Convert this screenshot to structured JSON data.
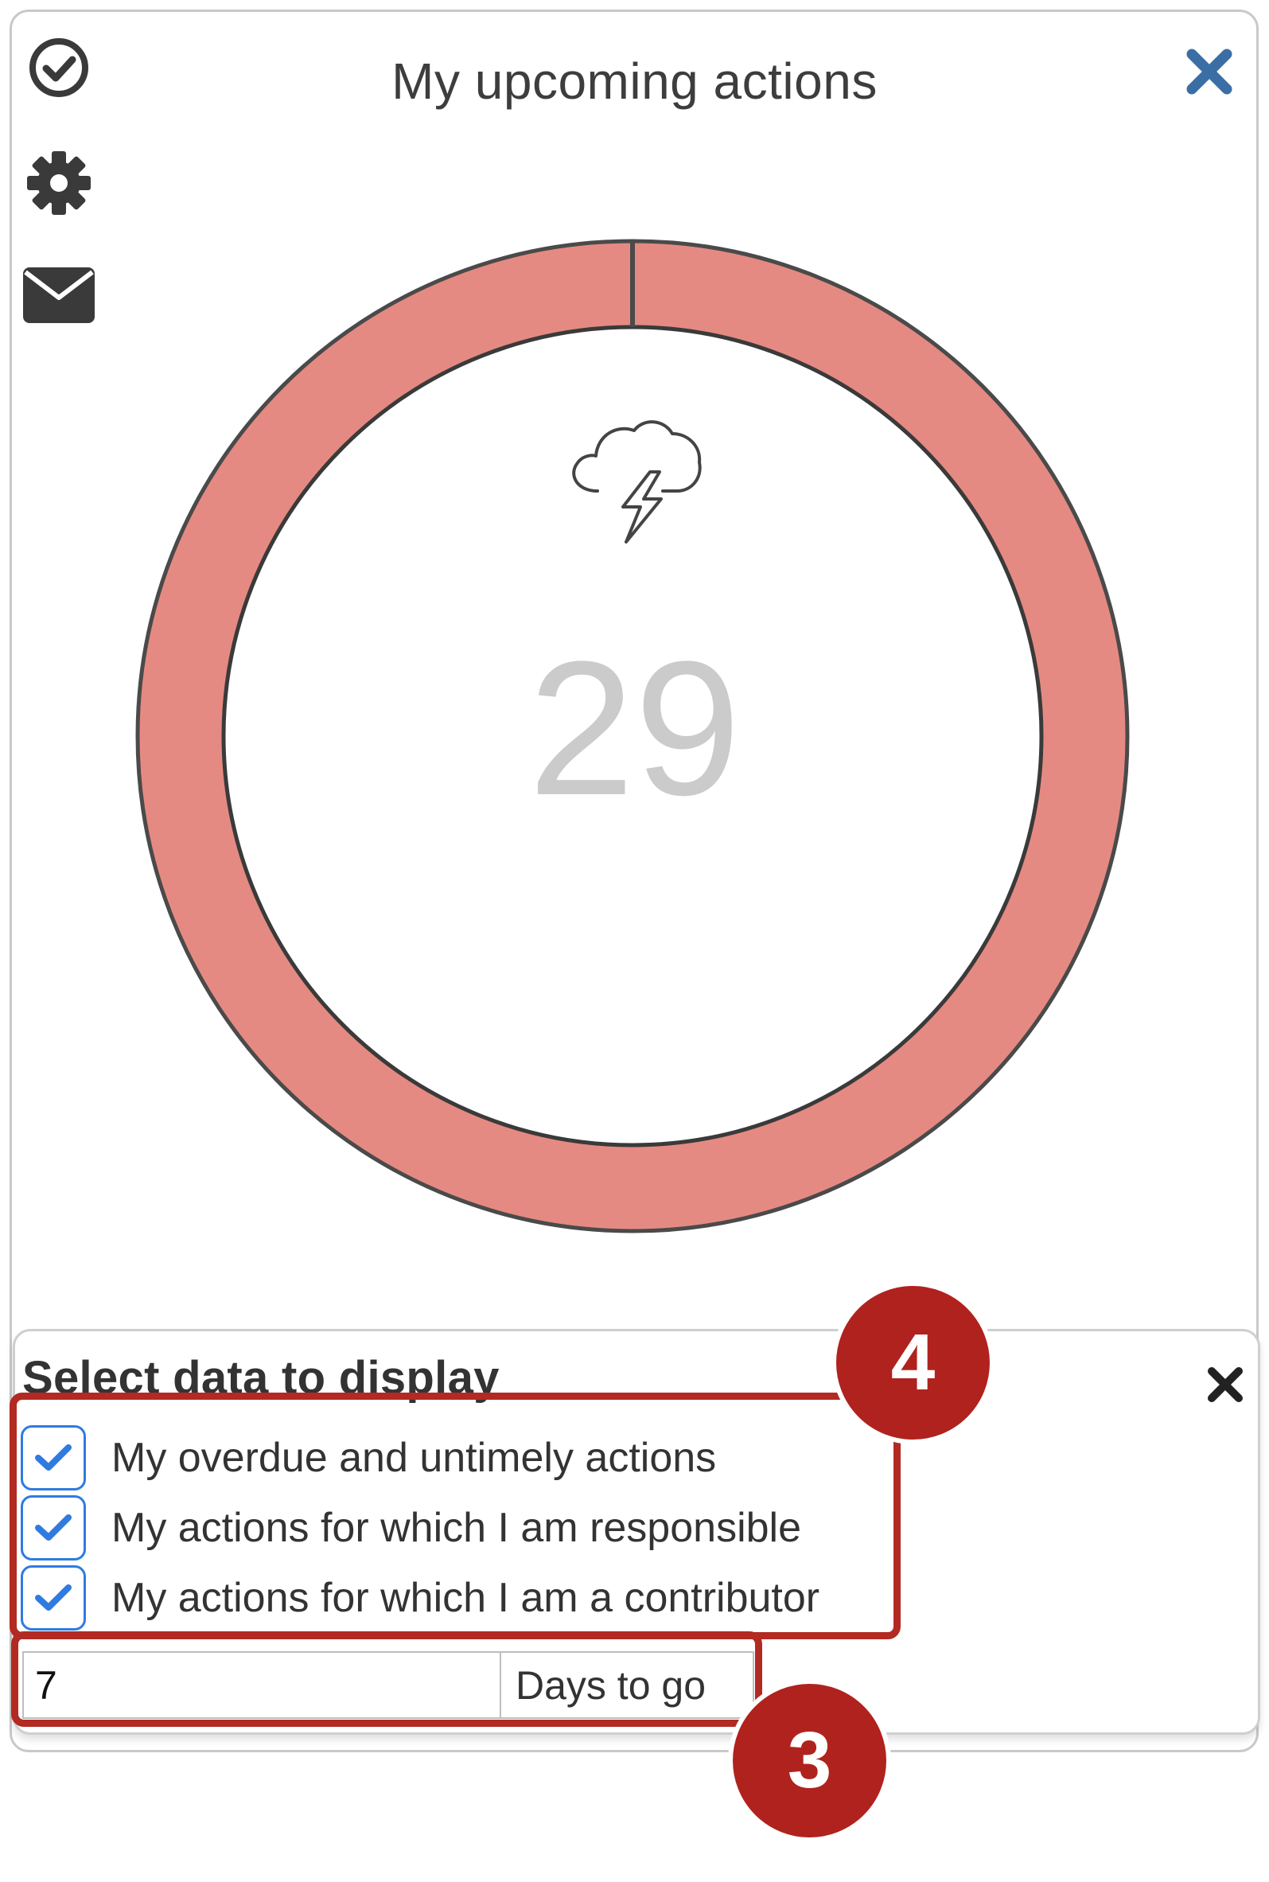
{
  "widget": {
    "title": "My upcoming actions",
    "count": "29",
    "status_icon": "thunderstorm-cloud-icon",
    "ring_color": "#e58a82",
    "side_icons": [
      "check-circle-icon",
      "gear-icon",
      "envelope-icon"
    ],
    "close_icon": "close-icon"
  },
  "panel": {
    "title": "Select data to display",
    "options": [
      {
        "label": "My overdue and untimely actions",
        "checked": true
      },
      {
        "label": "My actions for which I am responsible",
        "checked": true
      },
      {
        "label": "My actions for which I am a contributor",
        "checked": true
      }
    ],
    "days_value": "7",
    "days_suffix": "Days to go"
  },
  "callouts": {
    "checkbox_group_number": "4",
    "days_number": "3",
    "color": "#b0221e"
  }
}
